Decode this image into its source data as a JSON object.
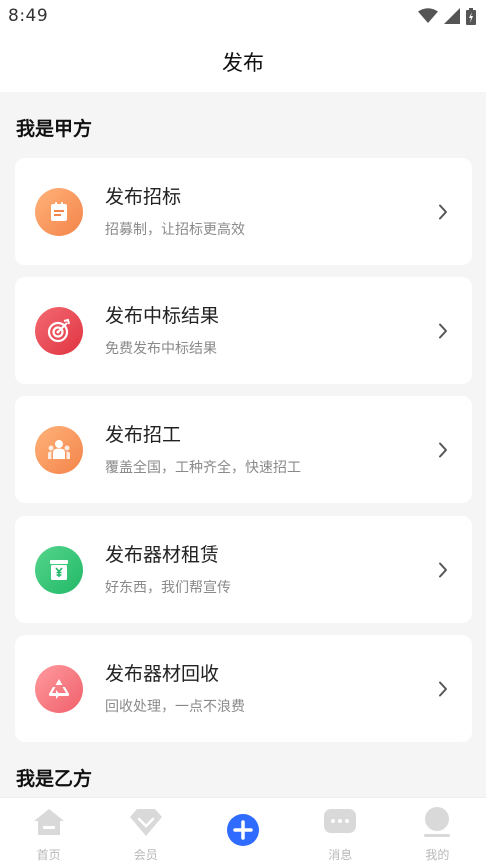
{
  "status": {
    "time": "8:49"
  },
  "nav": {
    "title": "发布"
  },
  "sections": [
    {
      "title": "我是甲方"
    },
    {
      "title": "我是乙方"
    }
  ],
  "cards": [
    {
      "title": "发布招标",
      "subtitle": "招募制，让招标更高效",
      "icon": "clipboard-icon",
      "color_from": "#ffb27a",
      "color_to": "#f3844a"
    },
    {
      "title": "发布中标结果",
      "subtitle": "免费发布中标结果",
      "icon": "target-icon",
      "color_from": "#f36a72",
      "color_to": "#e03441"
    },
    {
      "title": "发布招工",
      "subtitle": "覆盖全国，工种齐全，快速招工",
      "icon": "workers-icon",
      "color_from": "#ffb27a",
      "color_to": "#f3844a"
    },
    {
      "title": "发布器材租赁",
      "subtitle": "好东西，我们帮宣传",
      "icon": "yen-box-icon",
      "color_from": "#55d58d",
      "color_to": "#22b867"
    },
    {
      "title": "发布器材回收",
      "subtitle": "回收处理，一点不浪费",
      "icon": "recycle-icon",
      "color_from": "#ff9a9f",
      "color_to": "#f0606a"
    }
  ],
  "tabs": [
    {
      "label": "首页",
      "icon": "home-icon"
    },
    {
      "label": "会员",
      "icon": "diamond-icon"
    },
    {
      "label": "",
      "icon": "plus-icon"
    },
    {
      "label": "消息",
      "icon": "message-icon"
    },
    {
      "label": "我的",
      "icon": "user-icon"
    }
  ],
  "colors": {
    "accent": "#2f6bff",
    "tab_inactive": "#d9d9d9"
  }
}
